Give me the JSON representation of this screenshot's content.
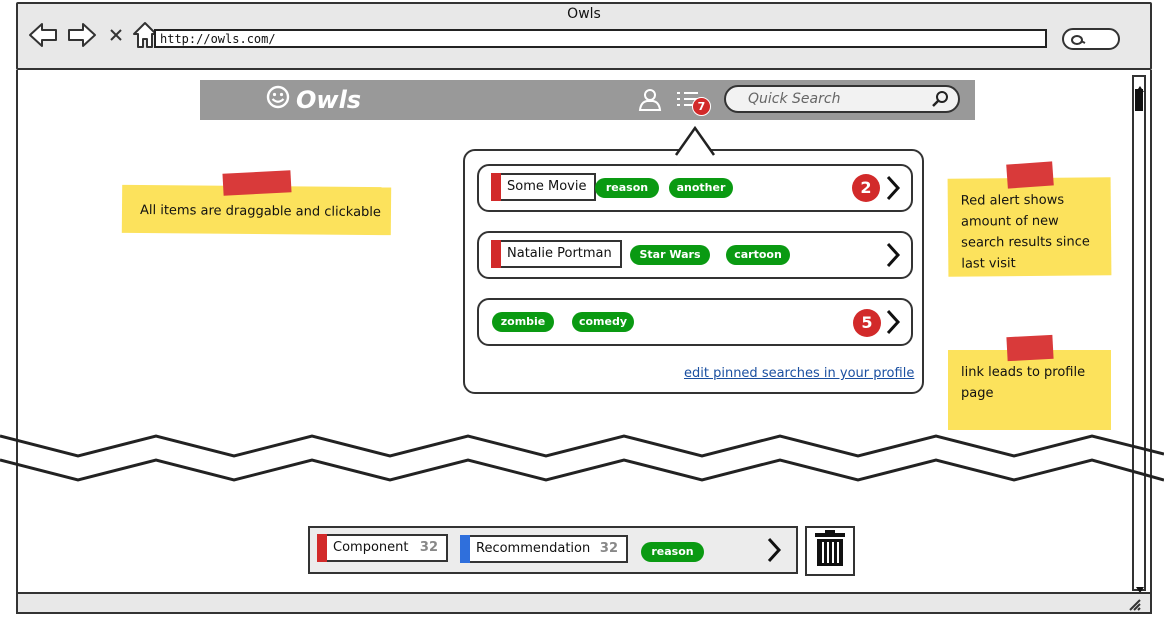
{
  "browser": {
    "title": "Owls",
    "url": "http://owls.com/"
  },
  "app": {
    "name": "Owls",
    "alerts_count": "7",
    "search_placeholder": "Quick Search"
  },
  "pinned_searches": [
    {
      "term": "Some Movie",
      "tags": [
        "reason",
        "another"
      ],
      "new_results": "2"
    },
    {
      "term": "Natalie Portman",
      "tags": [
        "Star Wars",
        "cartoon"
      ],
      "new_results": ""
    },
    {
      "term": "",
      "tags": [
        "zombie",
        "comedy"
      ],
      "new_results": "5"
    }
  ],
  "profile_link": "edit pinned searches in your profile",
  "notes": {
    "draggable": "All items are draggable and clickable",
    "alert": "Red alert shows amount of new search results since last visit",
    "link": "link leads to profile page"
  },
  "bottom_bar": {
    "component": {
      "label": "Component",
      "count": "32"
    },
    "recommendation": {
      "label": "Recommendation",
      "count": "32"
    },
    "tag": "reason"
  },
  "colors": {
    "header": "#999999",
    "tag_green": "#0a9a12",
    "alert_red": "#d22a2a",
    "note_yellow": "#fce25c",
    "link_blue": "#1a4fa0"
  },
  "icons": [
    "back-arrow-icon",
    "forward-arrow-icon",
    "close-icon",
    "home-icon",
    "search-icon",
    "smiley-icon",
    "user-icon",
    "list-icon",
    "chevron-right-icon",
    "trash-icon",
    "resize-grip-icon"
  ]
}
